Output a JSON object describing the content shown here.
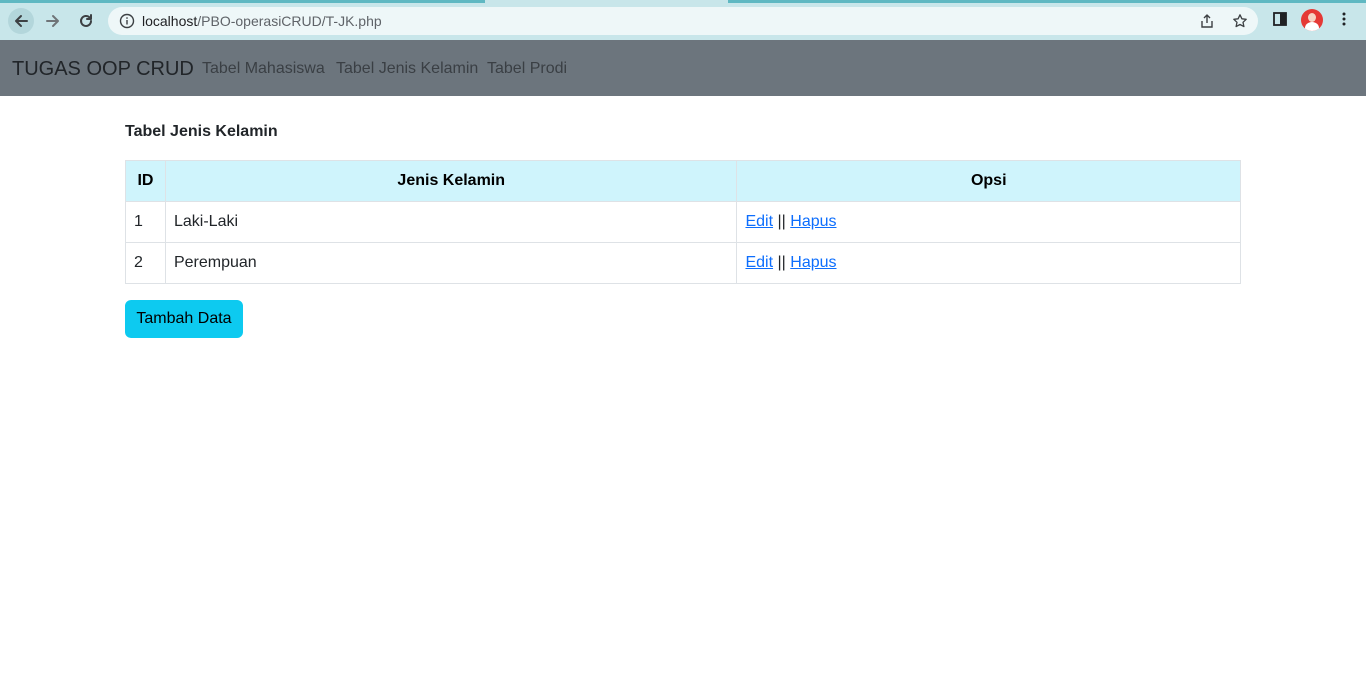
{
  "browser": {
    "url_host": "localhost",
    "url_path": "/PBO-operasiCRUD/T-JK.php",
    "accent_color": "#5fb8c2"
  },
  "navbar": {
    "brand": "TUGAS OOP CRUD",
    "links": [
      "Tabel Mahasiswa",
      "Tabel Jenis Kelamin",
      "Tabel Prodi"
    ],
    "background": "#6c757d"
  },
  "main": {
    "heading": "Tabel Jenis Kelamin",
    "table": {
      "headers": [
        "ID",
        "Jenis Kelamin",
        "Opsi"
      ],
      "rows": [
        {
          "id": "1",
          "jenis_kelamin": "Laki-Laki",
          "edit": "Edit",
          "separator": "||",
          "delete": "Hapus"
        },
        {
          "id": "2",
          "jenis_kelamin": "Perempuan",
          "edit": "Edit",
          "separator": "||",
          "delete": "Hapus"
        }
      ],
      "header_background": "#cff4fc"
    },
    "add_button": "Tambah Data",
    "add_button_color": "#0dcaf0"
  },
  "icons": [
    "back-arrow-icon",
    "forward-arrow-icon",
    "reload-icon",
    "info-icon",
    "share-icon",
    "star-icon",
    "sidebar-icon",
    "profile-avatar",
    "menu-dots-icon"
  ]
}
